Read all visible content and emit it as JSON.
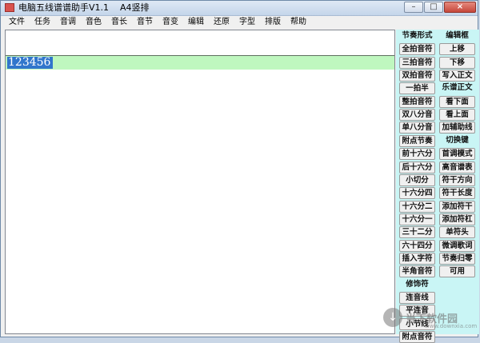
{
  "window": {
    "title": "电脑五线谱谱助手V1.1    A4竖排"
  },
  "menu": [
    "文件",
    "任务",
    "音调",
    "音色",
    "音长",
    "音节",
    "音变",
    "编辑",
    "还原",
    "字型",
    "排版",
    "帮助"
  ],
  "editor": {
    "selected_text": "123456"
  },
  "left_column": [
    {
      "label": "节奏形式",
      "kind": "label"
    },
    {
      "label": "全拍音符",
      "kind": "button"
    },
    {
      "label": "三拍音符",
      "kind": "button"
    },
    {
      "label": "双拍音符",
      "kind": "button"
    },
    {
      "label": "一拍半",
      "kind": "button"
    },
    {
      "label": "整拍音符",
      "kind": "button"
    },
    {
      "label": "双八分音",
      "kind": "button"
    },
    {
      "label": "单八分音",
      "kind": "button"
    },
    {
      "label": "附点节奏",
      "kind": "button"
    },
    {
      "label": "前十六分",
      "kind": "button"
    },
    {
      "label": "后十六分",
      "kind": "button"
    },
    {
      "label": "小切分",
      "kind": "button"
    },
    {
      "label": "十六分四",
      "kind": "button"
    },
    {
      "label": "十六分二",
      "kind": "button"
    },
    {
      "label": "十六分一",
      "kind": "button"
    },
    {
      "label": "三十二分",
      "kind": "button"
    },
    {
      "label": "六十四分",
      "kind": "button"
    },
    {
      "label": "插入字符",
      "kind": "button"
    },
    {
      "label": "半角音符",
      "kind": "button"
    },
    {
      "label": "修饰符",
      "kind": "label"
    },
    {
      "label": "连音线",
      "kind": "button"
    },
    {
      "label": "平连音",
      "kind": "button"
    },
    {
      "label": "小节线",
      "kind": "button"
    },
    {
      "label": "附点音符",
      "kind": "button"
    }
  ],
  "right_column": [
    {
      "label": "编辑框",
      "kind": "label"
    },
    {
      "label": "上移",
      "kind": "button"
    },
    {
      "label": "下移",
      "kind": "button"
    },
    {
      "label": "写入正文",
      "kind": "button"
    },
    {
      "label": "乐谱正文",
      "kind": "label"
    },
    {
      "label": "看下面",
      "kind": "button"
    },
    {
      "label": "看上面",
      "kind": "button"
    },
    {
      "label": "加辅助线",
      "kind": "button"
    },
    {
      "label": "切换键",
      "kind": "label"
    },
    {
      "label": "首调模式",
      "kind": "button"
    },
    {
      "label": "高音谱表",
      "kind": "button"
    },
    {
      "label": "符干方向",
      "kind": "button"
    },
    {
      "label": "符干长度",
      "kind": "button"
    },
    {
      "label": "添加符干",
      "kind": "button"
    },
    {
      "label": "添加符杠",
      "kind": "button"
    },
    {
      "label": "单符头",
      "kind": "button"
    },
    {
      "label": "微调歌词",
      "kind": "button"
    },
    {
      "label": "节奏归零",
      "kind": "button"
    },
    {
      "label": "可用",
      "kind": "button"
    }
  ],
  "watermark": {
    "text": "当下软件园",
    "url": "www.downxia.com"
  }
}
